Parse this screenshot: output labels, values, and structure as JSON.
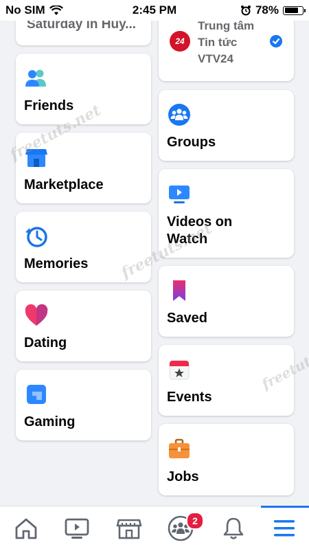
{
  "status_bar": {
    "carrier": "No SIM",
    "time": "2:45 PM",
    "battery_percent": "78%",
    "battery_level": 0.78
  },
  "shortcuts": {
    "partial_top": "Saturday in Huy...",
    "news_page": {
      "logo_text": "24",
      "title": "Trung tâm Tin tức VTV24"
    }
  },
  "menu_left": [
    {
      "label": "Friends",
      "icon": "friends-icon"
    },
    {
      "label": "Marketplace",
      "icon": "marketplace-icon"
    },
    {
      "label": "Memories",
      "icon": "memories-icon"
    },
    {
      "label": "Dating",
      "icon": "dating-icon"
    },
    {
      "label": "Gaming",
      "icon": "gaming-icon"
    }
  ],
  "menu_right": [
    {
      "label": "Groups",
      "icon": "groups-icon"
    },
    {
      "label": "Videos on Watch",
      "icon": "watch-icon"
    },
    {
      "label": "Saved",
      "icon": "saved-icon"
    },
    {
      "label": "Events",
      "icon": "events-icon"
    },
    {
      "label": "Jobs",
      "icon": "jobs-icon"
    }
  ],
  "tabbar": {
    "tabs": [
      "home-icon",
      "watch-tab-icon",
      "marketplace-tab-icon",
      "groups-tab-icon",
      "notifications-icon",
      "menu-icon"
    ],
    "groups_badge": "2"
  },
  "watermark": "freetuts.net",
  "colors": {
    "accent": "#1877f2",
    "badge": "#e41e3f",
    "background": "#f0f2f5"
  }
}
